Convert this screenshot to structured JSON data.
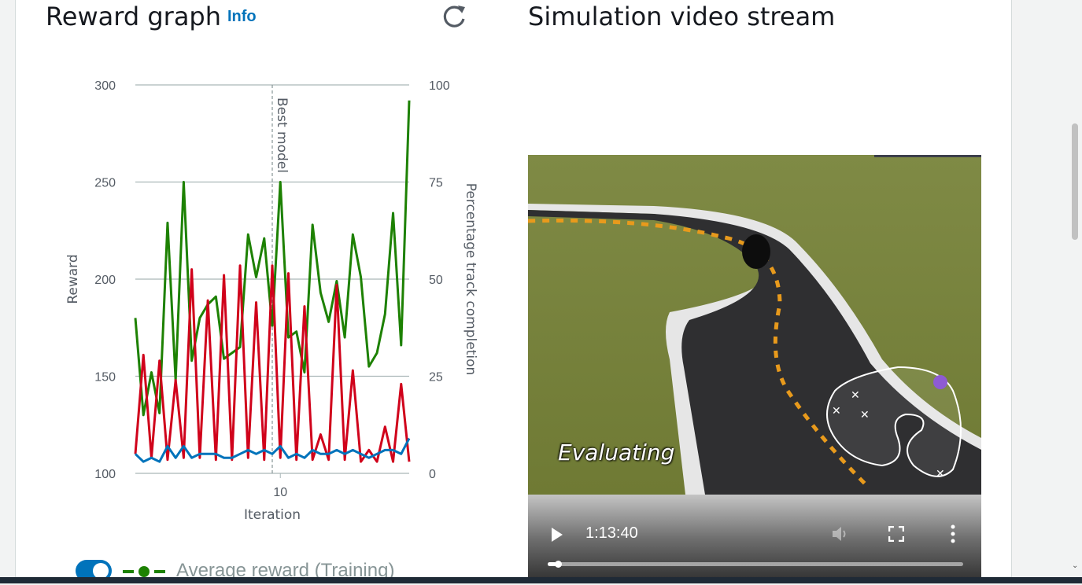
{
  "reward_panel": {
    "title": "Reward graph",
    "info_link": "Info",
    "refresh_icon": "refresh-icon"
  },
  "video_panel": {
    "title": "Simulation video stream",
    "overlay_text": "Evaluating",
    "time": "1:13:40",
    "progress_fraction": 0.02,
    "icons": [
      "play-icon",
      "volume-icon",
      "fullscreen-icon",
      "more-options-icon"
    ]
  },
  "legend": {
    "toggle_on": true,
    "average_reward_training": "Average reward (Training)"
  },
  "colors": {
    "accent": "#0073bb",
    "training_reward": "#1d8102",
    "evaluation_series": "#d0021b",
    "completion_series": "#0073bb"
  },
  "chart_data": {
    "type": "line",
    "xlabel": "Iteration",
    "ylabel": "Reward",
    "y2label": "Percentage track completion",
    "x_ticks": [
      10
    ],
    "y_ticks": [
      100,
      150,
      200,
      250,
      300
    ],
    "y2_ticks": [
      0,
      25,
      50,
      75,
      100
    ],
    "ylim": [
      100,
      300
    ],
    "y2lim": [
      0,
      100
    ],
    "xlim": [
      1,
      18
    ],
    "annotation": {
      "text": "Best model",
      "x": 9.5
    },
    "grid": true,
    "series": [
      {
        "axis": "left",
        "color": "#1d8102",
        "x": [
          1,
          1.5,
          2,
          2.5,
          3,
          3.5,
          4,
          4.5,
          5,
          5.5,
          6,
          6.5,
          7,
          7.5,
          8,
          8.5,
          9,
          9.5,
          10,
          10.5,
          11,
          11.5,
          12,
          12.5,
          13,
          13.5,
          14,
          14.5,
          15,
          15.5,
          16,
          16.5,
          17,
          17.5,
          18
        ],
        "values": [
          180,
          130,
          152,
          131,
          229,
          148,
          250,
          158,
          180,
          187,
          191,
          159,
          162,
          165,
          223,
          201,
          221,
          176,
          250,
          170,
          173,
          152,
          228,
          193,
          178,
          199,
          170,
          223,
          201,
          155,
          162,
          182,
          234,
          166,
          292
        ]
      },
      {
        "axis": "left",
        "color": "#d0021b",
        "x": [
          1,
          1.5,
          2,
          2.5,
          3,
          3.5,
          4,
          4.5,
          5,
          5.5,
          6,
          6.5,
          7,
          7.5,
          8,
          8.5,
          9,
          9.5,
          10,
          10.5,
          11,
          11.5,
          12,
          12.5,
          13,
          13.5,
          14,
          14.5,
          15,
          15.5,
          16,
          16.5,
          17,
          17.5,
          18
        ],
        "values": [
          110,
          161,
          108,
          158,
          107,
          148,
          108,
          205,
          108,
          189,
          107,
          202,
          107,
          207,
          108,
          188,
          107,
          207,
          108,
          203,
          107,
          186,
          107,
          120,
          107,
          197,
          107,
          153,
          106,
          112,
          106,
          124,
          106,
          146,
          106
        ]
      },
      {
        "axis": "right",
        "color": "#0073bb",
        "x": [
          1,
          1.5,
          2,
          2.5,
          3,
          3.5,
          4,
          4.5,
          5,
          5.5,
          6,
          6.5,
          7,
          7.5,
          8,
          8.5,
          9,
          9.5,
          10,
          10.5,
          11,
          11.5,
          12,
          12.5,
          13,
          13.5,
          14,
          14.5,
          15,
          15.5,
          16,
          16.5,
          17,
          17.5,
          18
        ],
        "values": [
          5,
          3,
          4,
          3,
          7,
          4,
          7,
          4,
          5,
          5,
          5,
          4,
          4,
          5,
          6,
          5,
          6,
          5,
          7,
          4,
          5,
          4,
          6,
          5,
          5,
          6,
          5,
          6,
          5,
          4,
          5,
          6,
          6,
          5,
          9
        ]
      }
    ]
  }
}
